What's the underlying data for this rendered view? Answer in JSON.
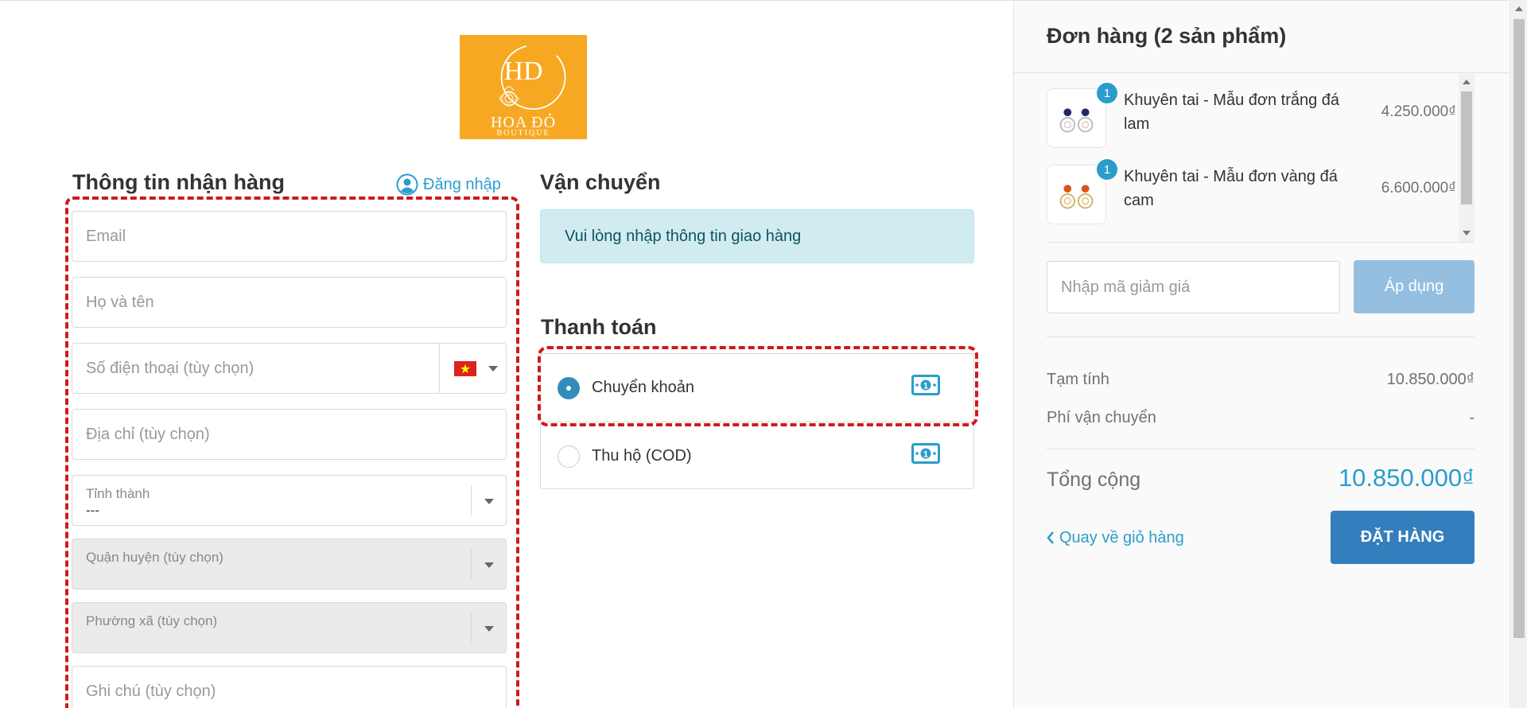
{
  "logo": {
    "name": "HOA ĐỎ",
    "sub": "BOUTIQUE",
    "monogram": "HD",
    "background": "#f7a823"
  },
  "shipping_info": {
    "title": "Thông tin nhận hàng",
    "login_label": "Đăng nhập",
    "fields": {
      "email": "Email",
      "full_name": "Họ và tên",
      "phone": "Số điện thoại (tùy chọn)",
      "address": "Địa chỉ (tùy chọn)",
      "province_label": "Tỉnh thành",
      "province_value": "---",
      "district_label": "Quận huyện (tùy chọn)",
      "ward_label": "Phường xã (tùy chọn)",
      "note": "Ghi chú (tùy chọn)"
    }
  },
  "shipping": {
    "title": "Vận chuyển",
    "alert": "Vui lòng nhập thông tin giao hàng"
  },
  "payment": {
    "title": "Thanh toán",
    "options": [
      {
        "label": "Chuyển khoản",
        "selected": true,
        "icon": "cash-icon"
      },
      {
        "label": "Thu hộ (COD)",
        "selected": false,
        "icon": "cash-icon"
      }
    ]
  },
  "order": {
    "title": "Đơn hàng (2 sản phẩm)",
    "items": [
      {
        "qty": "1",
        "name": "Khuyên tai - Mẫu đơn trắng đá lam",
        "price": "4.250.000₫",
        "stone_color": "#1f2a6b"
      },
      {
        "qty": "1",
        "name": "Khuyên tai - Mẫu đơn vàng đá cam",
        "price": "6.600.000₫",
        "stone_color": "#d9541c"
      }
    ],
    "discount_placeholder": "Nhập mã giảm giá",
    "apply_label": "Áp dụng",
    "subtotal_label": "Tạm tính",
    "subtotal_value": "10.850.000₫",
    "shipping_fee_label": "Phí vận chuyển",
    "shipping_fee_value": "-",
    "total_label": "Tổng cộng",
    "total_value": "10.850.000₫",
    "back_label": "Quay về giỏ hàng",
    "place_order_label": "ĐẶT HÀNG"
  },
  "colors": {
    "accent": "#2a9dcc",
    "primary_button": "#357ebd",
    "highlight": "#d0191d"
  }
}
